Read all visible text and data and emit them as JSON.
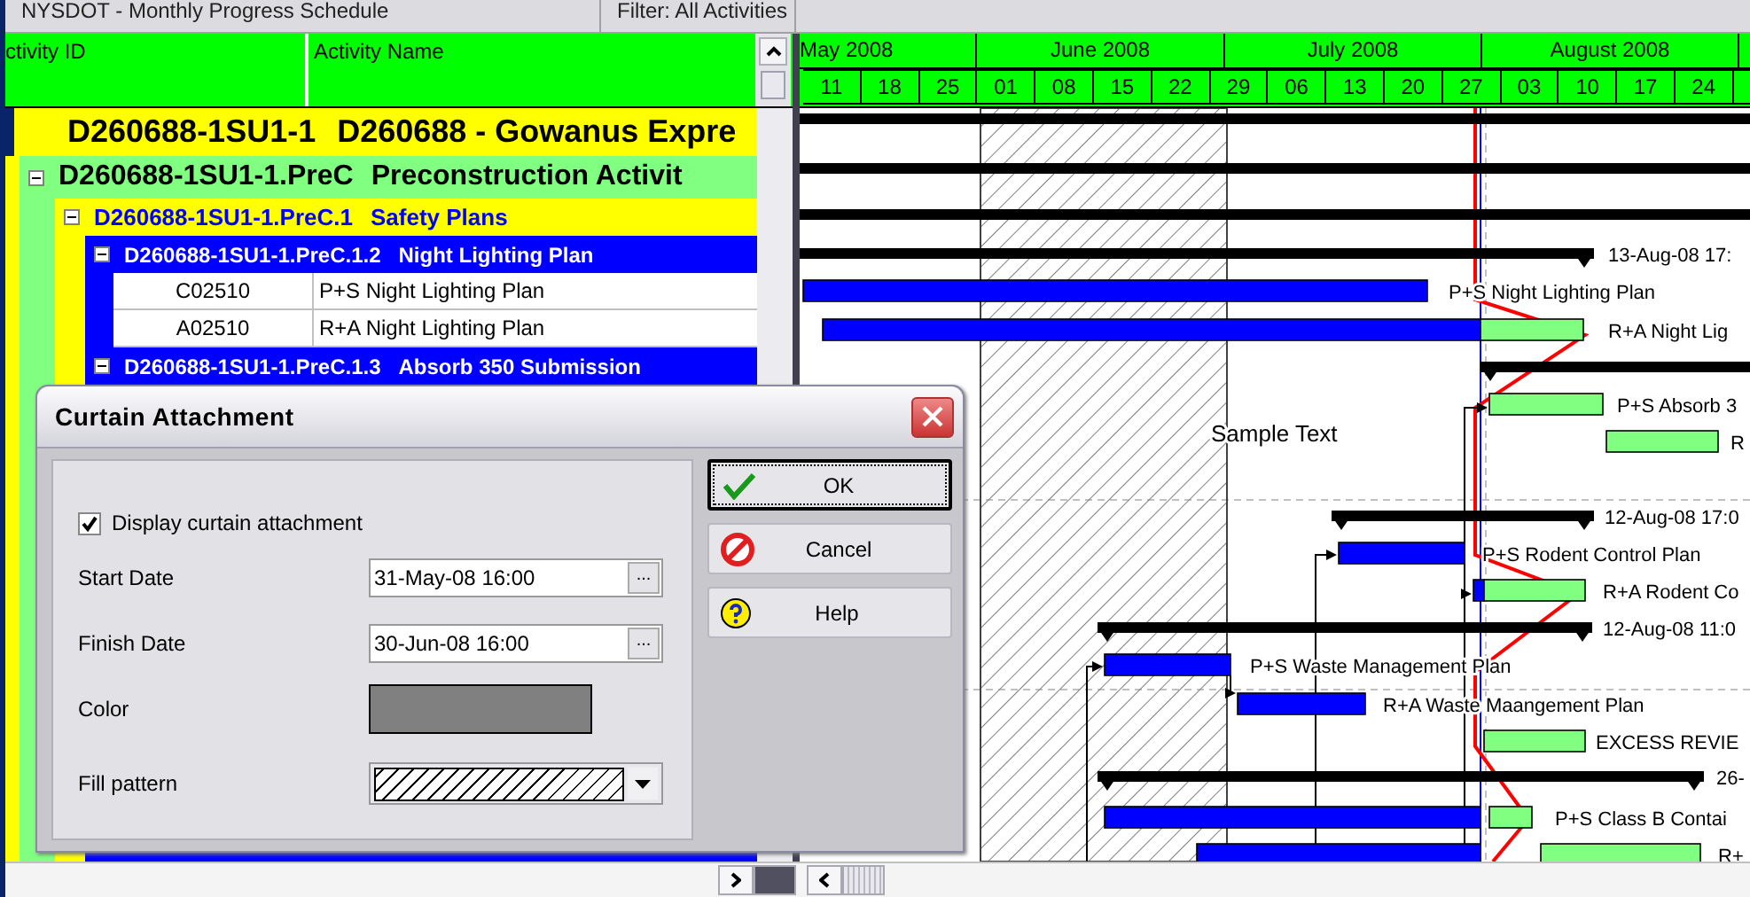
{
  "top_bar": {
    "layout_name": "NYSDOT - Monthly Progress Schedule",
    "filter": "Filter: All Activities"
  },
  "columns": [
    {
      "label": "ctivity ID"
    },
    {
      "label": "Activity Name"
    }
  ],
  "timescale": {
    "months": [
      "May 2008",
      "June 2008",
      "July 2008",
      "August 2008"
    ],
    "weeks": [
      "11",
      "18",
      "25",
      "01",
      "08",
      "15",
      "22",
      "29",
      "06",
      "13",
      "20",
      "27",
      "03",
      "10",
      "17",
      "24"
    ]
  },
  "tree": [
    {
      "code": "D260688-1SU1-1",
      "name": "D260688 - Gowanus Expre",
      "children": [
        {
          "code": "D260688-1SU1-1.PreC",
          "name": "Preconstruction Activit",
          "expanded": true,
          "children": [
            {
              "code": "D260688-1SU1-1.PreC.1",
              "name": "Safety Plans",
              "expanded": true,
              "children": [
                {
                  "code": "D260688-1SU1-1.PreC.1.2",
                  "name": "Night Lighting Plan",
                  "expanded": true,
                  "children": [
                    {
                      "activity_id": "C02510",
                      "activity_name": "P+S Night Lighting Plan"
                    },
                    {
                      "activity_id": "A02510",
                      "activity_name": "R+A Night Lighting Plan"
                    }
                  ]
                },
                {
                  "code": "D260688-1SU1-1.PreC.1.3",
                  "name": "Absorb 350 Submission",
                  "expanded": true
                }
              ]
            }
          ]
        }
      ]
    }
  ],
  "gantt": {
    "curtain_text": "Sample Text",
    "rows": [
      {
        "kind": "summary"
      },
      {
        "kind": "summary"
      },
      {
        "kind": "summary"
      },
      {
        "kind": "summary",
        "label": "13-Aug-08 17:"
      },
      {
        "kind": "task",
        "label": "P+S Night Lighting Plan"
      },
      {
        "kind": "task",
        "label": "R+A Night Lig"
      },
      {
        "kind": "summary"
      },
      {
        "kind": "task",
        "label": "P+S Absorb 3"
      },
      {
        "kind": "task",
        "label": "R"
      },
      {
        "kind": "summary",
        "label": "12-Aug-08 17:0"
      },
      {
        "kind": "task",
        "label": "P+S Rodent Control Plan"
      },
      {
        "kind": "task",
        "label": "R+A Rodent Co"
      },
      {
        "kind": "summary",
        "label": "12-Aug-08 11:0"
      },
      {
        "kind": "task",
        "label": "P+S Waste Management Plan"
      },
      {
        "kind": "task",
        "label": "R+A Waste Maangement Plan"
      },
      {
        "kind": "task",
        "label": "EXCESS REVIE"
      },
      {
        "kind": "summary",
        "label": "26-"
      },
      {
        "kind": "task",
        "label": "P+S Class B Contai"
      },
      {
        "kind": "task",
        "label": "R+"
      }
    ]
  },
  "dialog": {
    "title": "Curtain Attachment",
    "display_curtain": {
      "label": "Display curtain attachment",
      "checked": true
    },
    "start_date": {
      "label": "Start Date",
      "value": "31-May-08 16:00",
      "browse_label": "..."
    },
    "finish_date": {
      "label": "Finish Date",
      "value": "30-Jun-08 16:00",
      "browse_label": "..."
    },
    "color": {
      "label": "Color",
      "color": "#808080"
    },
    "fill_pattern": {
      "label": "Fill pattern"
    },
    "buttons": [
      {
        "kind": "ok",
        "label": "OK"
      },
      {
        "kind": "cancel",
        "label": "Cancel"
      },
      {
        "kind": "help",
        "label": "Help"
      }
    ]
  }
}
